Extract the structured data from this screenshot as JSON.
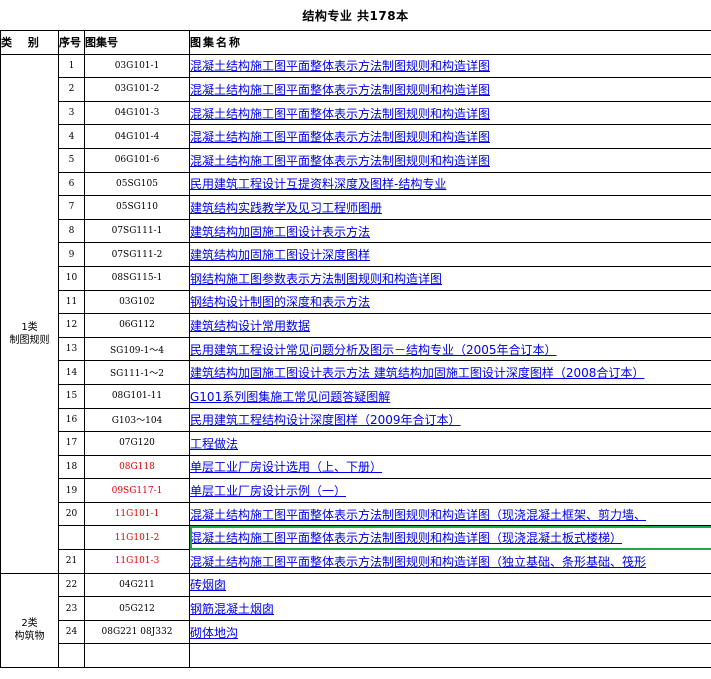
{
  "title": "结构专业  共178本",
  "headers": {
    "category": "类 别",
    "no": "序号",
    "code": "图集号",
    "name": "图集名称"
  },
  "categories": [
    {
      "label_line1": "1类",
      "label_line2": "制图规则"
    },
    {
      "label_line1": "2类",
      "label_line2": "构筑物"
    }
  ],
  "rows": [
    {
      "no": "1",
      "code": "03G101-1",
      "name": "混凝土结构施工图平面整体表示方法制图规则和构造详图"
    },
    {
      "no": "2",
      "code": "03G101-2",
      "name": "混凝土结构施工图平面整体表示方法制图规则和构造详图"
    },
    {
      "no": "3",
      "code": "04G101-3",
      "name": "混凝土结构施工图平面整体表示方法制图规则和构造详图"
    },
    {
      "no": "4",
      "code": "04G101-4",
      "name": "混凝土结构施工图平面整体表示方法制图规则和构造详图"
    },
    {
      "no": "5",
      "code": "06G101-6",
      "name": "混凝土结构施工图平面整体表示方法制图规则和构造详图"
    },
    {
      "no": "6",
      "code": "05SG105",
      "name": "民用建筑工程设计互提资料深度及图样-结构专业"
    },
    {
      "no": "7",
      "code": "05SG110",
      "name": "建筑结构实践教学及见习工程师图册"
    },
    {
      "no": "8",
      "code": "07SG111-1",
      "name": "建筑结构加固施工图设计表示方法"
    },
    {
      "no": "9",
      "code": "07SG111-2",
      "name": "建筑结构加固施工图设计深度图样"
    },
    {
      "no": "10",
      "code": "08SG115-1",
      "name": "钢结构施工图参数表示方法制图规则和构造详图"
    },
    {
      "no": "11",
      "code": "03G102",
      "name": "钢结构设计制图的深度和表示方法"
    },
    {
      "no": "12",
      "code": "06G112",
      "name": "建筑结构设计常用数据"
    },
    {
      "no": "13",
      "code": "SG109-1～4",
      "name": "民用建筑工程设计常见问题分析及图示－结构专业（2005年合订本）"
    },
    {
      "no": "14",
      "code": "SG111-1～2",
      "name": "建筑结构加固施工图设计表示方法 建筑结构加固施工图设计深度图样（2008合订本）"
    },
    {
      "no": "15",
      "code": "08G101-11",
      "name": "G101系列图集施工常见问题答疑图解"
    },
    {
      "no": "16",
      "code": "G103～104",
      "name": "民用建筑工程结构设计深度图样（2009年合订本）"
    },
    {
      "no": "17",
      "code": "07G120",
      "name": "工程做法"
    },
    {
      "no": "18",
      "code": "08G118",
      "name": "单层工业厂房设计选用（上、下册）",
      "red": true
    },
    {
      "no": "19",
      "code": "09SG117-1",
      "name": "单层工业厂房设计示例（一）",
      "red": true
    },
    {
      "no": "20",
      "code": "11G101-1",
      "name": "混凝土结构施工图平面整体表示方法制图规则和构造详图（现浇混凝土框架、剪力墙、",
      "red": true
    },
    {
      "no": "",
      "code": "11G101-2",
      "name": "混凝土结构施工图平面整体表示方法制图规则和构造详图（现浇混凝土板式楼梯）",
      "red": true,
      "selected": true
    },
    {
      "no": "21",
      "code": "11G101-3",
      "name": "混凝土结构施工图平面整体表示方法制图规则和构造详图（独立基础、条形基础、筏形",
      "red": true
    },
    {
      "no": "22",
      "code": "04G211",
      "name": "砖烟囱"
    },
    {
      "no": "23",
      "code": "05G212",
      "name": "钢筋混凝土烟囱"
    },
    {
      "no": "24",
      "code": "08G221 08J332",
      "name": "砌体地沟"
    },
    {
      "no": "",
      "code": "",
      "name": ""
    }
  ]
}
